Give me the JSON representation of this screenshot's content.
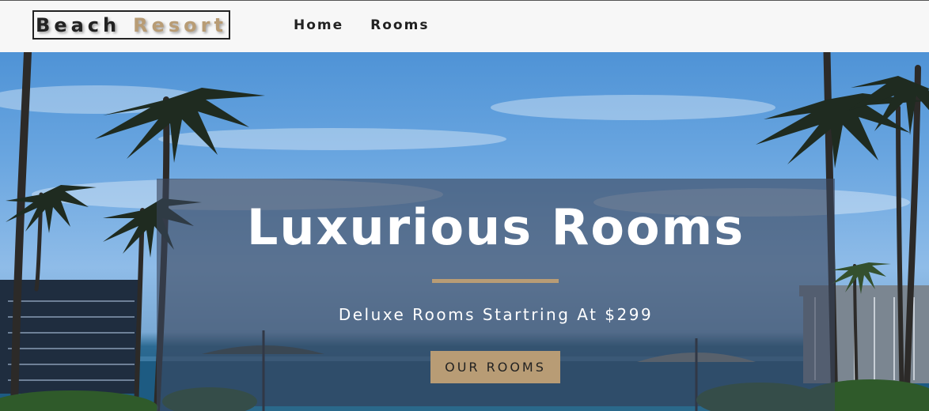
{
  "navbar": {
    "logo_word1": "Beach",
    "logo_word2": "Resort",
    "links": [
      {
        "label": "Home"
      },
      {
        "label": "Rooms"
      }
    ]
  },
  "hero": {
    "title": "Luxurious Rooms",
    "subtitle": "Deluxe Rooms Startring At $299",
    "button_label": "OUR ROOMS"
  },
  "colors": {
    "accent": "#b89c75",
    "nav_bg": "#f7f7f7",
    "text_dark": "#222222",
    "banner_overlay": "rgba(58,70,92,0.62)"
  }
}
